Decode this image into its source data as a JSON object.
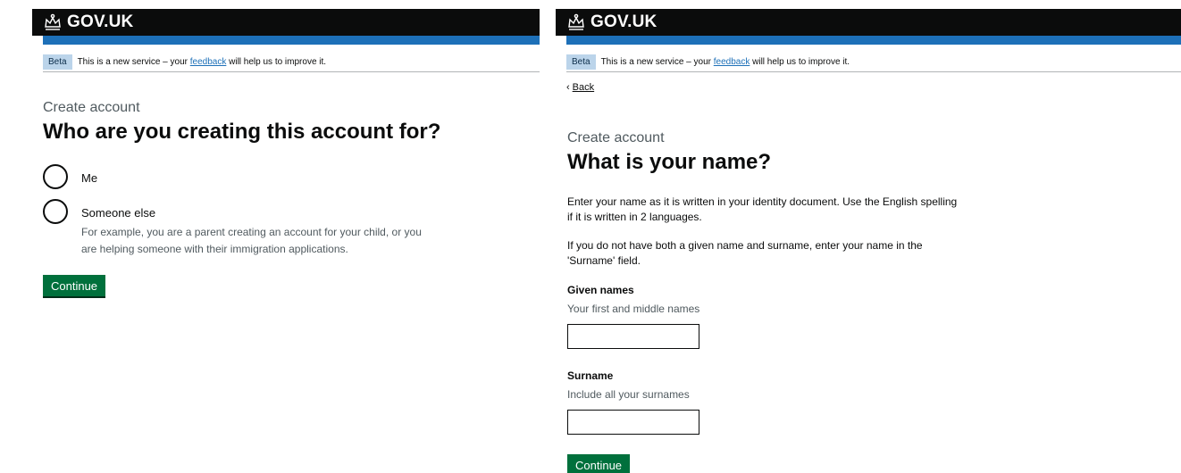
{
  "header": {
    "logotype": "GOV.UK",
    "crown_icon": "crown-icon"
  },
  "phase_banner": {
    "tag": "Beta",
    "text_before": "This is a new service – your",
    "link": "feedback",
    "text_after": "will help us to improve it."
  },
  "left": {
    "caption": "Create account",
    "heading": "Who are you creating this account for?",
    "options": [
      {
        "label": "Me"
      },
      {
        "label": "Someone else",
        "hint": "For example, you are a parent creating an account for your child, or you are helping someone with their immigration applications."
      }
    ],
    "continue": "Continue"
  },
  "right": {
    "back": "Back",
    "caption": "Create account",
    "heading": "What is your name?",
    "para1": "Enter your name as it is written in your identity document. Use the English spelling if it is written in 2 languages.",
    "para2": "If you do not have both a given name and surname, enter your name in the 'Surname' field.",
    "given": {
      "label": "Given names",
      "hint": "Your first and middle names",
      "value": ""
    },
    "surname": {
      "label": "Surname",
      "hint": "Include all your surnames",
      "value": ""
    },
    "continue": "Continue"
  },
  "colors": {
    "header": "#0b0c0c",
    "brand_blue": "#1d70b8",
    "button_green": "#00703c",
    "phase_tag": "#bbd4ea"
  }
}
